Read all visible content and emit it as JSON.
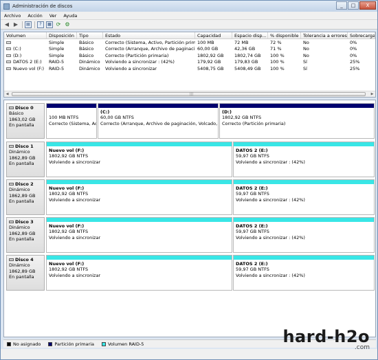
{
  "window": {
    "title": "Administración de discos",
    "buttons": [
      "_",
      "□",
      "X"
    ]
  },
  "menu": [
    "Archivo",
    "Acción",
    "Ver",
    "Ayuda"
  ],
  "toolbar": [
    "back-arrow-icon",
    "forward-arrow-icon",
    "list-view-icon",
    "help-icon",
    "properties-icon",
    "refresh-icon",
    "settings-icon"
  ],
  "volumes": {
    "columns": [
      "Volumen",
      "Disposición",
      "Tipo",
      "Estado",
      "Capacidad",
      "Espacio disp...",
      "% disponible",
      "Tolerancia a errores",
      "Sobrecarga"
    ],
    "rows": [
      [
        "",
        "Simple",
        "Básico",
        "Correcto (Sistema, Activo, Partición prim...",
        "100 MB",
        "72 MB",
        "72 %",
        "No",
        "0%"
      ],
      [
        "(C:)",
        "Simple",
        "Básico",
        "Correcto (Arranque, Archivo de paginaci...",
        "60,00 GB",
        "42,36 GB",
        "71 %",
        "No",
        "0%"
      ],
      [
        "(D:)",
        "Simple",
        "Básico",
        "Correcto (Partición primaria)",
        "1802,92 GB",
        "1802,74 GB",
        "100 %",
        "No",
        "0%"
      ],
      [
        "DATOS 2 (E:)",
        "RAID-5",
        "Dinámico",
        "Volviendo a sincronizar : (42%)",
        "179,92 GB",
        "179,83 GB",
        "100 %",
        "Sí",
        "25%"
      ],
      [
        "Nuevo vol (F:)",
        "RAID-5",
        "Dinámico",
        "Volviendo a sincronizar",
        "5408,75 GB",
        "5408,49 GB",
        "100 %",
        "Sí",
        "25%"
      ]
    ]
  },
  "disks": [
    {
      "name": "Disco 0",
      "type": "Básico",
      "size": "1863,02 GB",
      "status": "En pantalla",
      "partitions": [
        {
          "name": "",
          "size": "100 MB NTFS",
          "state": "Correcto (Sistema, Ac",
          "kind": "primary"
        },
        {
          "name": "(C:)",
          "size": "60,00 GB NTFS",
          "state": "Correcto (Arranque, Archivo de paginación, Volcado, Par",
          "kind": "primary"
        },
        {
          "name": "(D:)",
          "size": "1802,92 GB NTFS",
          "state": "Correcto (Partición primaria)",
          "kind": "primary"
        }
      ]
    },
    {
      "name": "Disco 1",
      "type": "Dinámico",
      "size": "1862,89 GB",
      "status": "En pantalla",
      "partitions": [
        {
          "name": "Nuevo vol  (F:)",
          "size": "1802,92 GB NTFS",
          "state": "Volviendo a sincronizar",
          "kind": "raid"
        },
        {
          "name": "DATOS 2  (E:)",
          "size": "59,97 GB NTFS",
          "state": "Volviendo a sincronizar : (42%)",
          "kind": "raid"
        }
      ]
    },
    {
      "name": "Disco 2",
      "type": "Dinámico",
      "size": "1862,89 GB",
      "status": "En pantalla",
      "partitions": [
        {
          "name": "Nuevo vol  (F:)",
          "size": "1802,92 GB NTFS",
          "state": "Volviendo a sincronizar",
          "kind": "raid"
        },
        {
          "name": "DATOS 2  (E:)",
          "size": "59,97 GB NTFS",
          "state": "Volviendo a sincronizar : (42%)",
          "kind": "raid"
        }
      ]
    },
    {
      "name": "Disco 3",
      "type": "Dinámico",
      "size": "1862,89 GB",
      "status": "En pantalla",
      "partitions": [
        {
          "name": "Nuevo vol  (F:)",
          "size": "1802,92 GB NTFS",
          "state": "Volviendo a sincronizar",
          "kind": "raid"
        },
        {
          "name": "DATOS 2  (E:)",
          "size": "59,97 GB NTFS",
          "state": "Volviendo a sincronizar : (42%)",
          "kind": "raid"
        }
      ]
    },
    {
      "name": "Disco 4",
      "type": "Dinámico",
      "size": "1862,89 GB",
      "status": "En pantalla",
      "partitions": [
        {
          "name": "Nuevo vol  (F:)",
          "size": "1802,92 GB NTFS",
          "state": "Volviendo a sincronizar",
          "kind": "raid"
        },
        {
          "name": "DATOS 2  (E:)",
          "size": "59,97 GB NTFS",
          "state": "Volviendo a sincronizar : (42%)",
          "kind": "raid"
        }
      ]
    }
  ],
  "legend": [
    {
      "label": "No asignado",
      "color": "#000000"
    },
    {
      "label": "Partición primaria",
      "color": "#00006e"
    },
    {
      "label": "Volumen RAID-5",
      "color": "#39e6e6"
    }
  ],
  "watermark": {
    "main": "hard-h2o",
    "sub": ".com"
  }
}
